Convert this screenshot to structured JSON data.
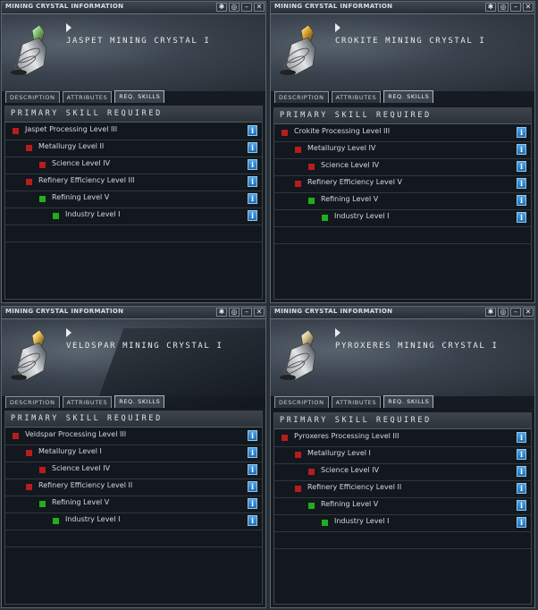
{
  "windows": [
    {
      "title": "MINING CRYSTAL INFORMATION",
      "item_name": "JASPET MINING CRYSTAL I",
      "crystal_color": "#7ec870",
      "tabs": [
        {
          "label": "DESCRIPTION"
        },
        {
          "label": "ATTRIBUTES"
        },
        {
          "label": "REQ. SKILLS",
          "active": true
        }
      ],
      "section_title": "PRIMARY SKILL REQUIRED",
      "skills": [
        {
          "label": "Jaspet Processing Level III",
          "level": 0,
          "status": "red"
        },
        {
          "label": "Metallurgy Level II",
          "level": 1,
          "status": "red"
        },
        {
          "label": "Science Level IV",
          "level": 2,
          "status": "red"
        },
        {
          "label": "Refinery Efficiency Level III",
          "level": 1,
          "status": "red"
        },
        {
          "label": "Refining Level V",
          "level": 2,
          "status": "green"
        },
        {
          "label": "Industry Level I",
          "level": 3,
          "status": "green"
        }
      ]
    },
    {
      "title": "MINING CRYSTAL INFORMATION",
      "item_name": "CROKITE MINING CRYSTAL I",
      "crystal_color": "#e0a62a",
      "tabs": [
        {
          "label": "DESCRIPTION"
        },
        {
          "label": "ATTRIBUTES"
        },
        {
          "label": "REQ. SKILLS",
          "active": true
        }
      ],
      "section_title": "PRIMARY SKILL REQUIRED",
      "skills": [
        {
          "label": "Crokite Processing Level III",
          "level": 0,
          "status": "red"
        },
        {
          "label": "Metallurgy Level IV",
          "level": 1,
          "status": "red"
        },
        {
          "label": "Science Level IV",
          "level": 2,
          "status": "red"
        },
        {
          "label": "Refinery Efficiency Level V",
          "level": 1,
          "status": "red"
        },
        {
          "label": "Refining Level V",
          "level": 2,
          "status": "green"
        },
        {
          "label": "Industry Level I",
          "level": 3,
          "status": "green"
        }
      ]
    },
    {
      "title": "MINING CRYSTAL INFORMATION",
      "item_name": "VELDSPAR MINING CRYSTAL I",
      "crystal_color": "#e8c24a",
      "tabs": [
        {
          "label": "DESCRIPTION"
        },
        {
          "label": "ATTRIBUTES"
        },
        {
          "label": "REQ. SKILLS",
          "active": true
        }
      ],
      "section_title": "PRIMARY SKILL REQUIRED",
      "skills": [
        {
          "label": "Veldspar Processing Level III",
          "level": 0,
          "status": "red"
        },
        {
          "label": "Metallurgy Level I",
          "level": 1,
          "status": "red"
        },
        {
          "label": "Science Level IV",
          "level": 2,
          "status": "red"
        },
        {
          "label": "Refinery Efficiency Level II",
          "level": 1,
          "status": "red"
        },
        {
          "label": "Refining Level V",
          "level": 2,
          "status": "green"
        },
        {
          "label": "Industry Level I",
          "level": 3,
          "status": "green"
        }
      ]
    },
    {
      "title": "MINING CRYSTAL INFORMATION",
      "item_name": "PYROXERES MINING CRYSTAL I",
      "crystal_color": "#d9c890",
      "tabs": [
        {
          "label": "DESCRIPTION"
        },
        {
          "label": "ATTRIBUTES"
        },
        {
          "label": "REQ. SKILLS",
          "active": true
        }
      ],
      "section_title": "PRIMARY SKILL REQUIRED",
      "skills": [
        {
          "label": "Pyroxeres Processing Level III",
          "level": 0,
          "status": "red"
        },
        {
          "label": "Metallurgy Level I",
          "level": 1,
          "status": "red"
        },
        {
          "label": "Science Level IV",
          "level": 2,
          "status": "red"
        },
        {
          "label": "Refinery Efficiency Level II",
          "level": 1,
          "status": "red"
        },
        {
          "label": "Refining Level V",
          "level": 2,
          "status": "green"
        },
        {
          "label": "Industry Level I",
          "level": 3,
          "status": "green"
        }
      ]
    }
  ],
  "colors": {
    "status_red": "#b81c1c",
    "status_green": "#1fae1f",
    "info_button": "#2f86d0"
  },
  "icons": {
    "window_buttons": [
      "pin-icon",
      "settings-icon",
      "minimize-icon",
      "close-icon"
    ],
    "info": "info-icon",
    "tab_marker": "play-icon"
  }
}
